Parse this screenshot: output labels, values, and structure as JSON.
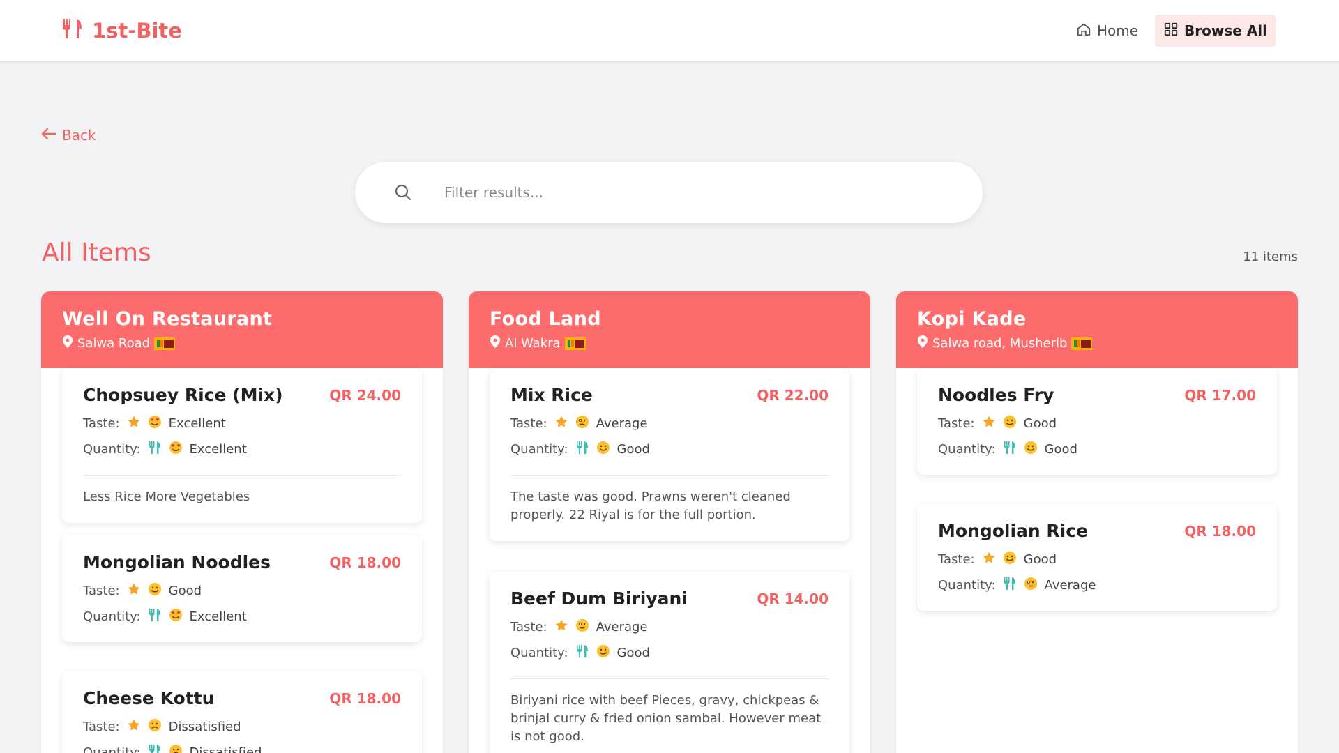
{
  "app": {
    "brand": "1st-Bite"
  },
  "nav": {
    "home": "Home",
    "browse_all": "Browse All"
  },
  "back_label": "Back",
  "search": {
    "placeholder": "Filter results..."
  },
  "section": {
    "title": "All Items",
    "count": "11 items"
  },
  "columns": [
    {
      "name": "Well On Restaurant",
      "location": "Salwa Road",
      "items": [
        {
          "name": "Chopsuey Rice (Mix)",
          "price": "QR 24.00",
          "taste_label": "Taste:",
          "taste": "Excellent",
          "taste_icon": "heart-eyes",
          "quantity_label": "Quantity:",
          "quantity": "Excellent",
          "quantity_icon": "heart-eyes",
          "note": "Less Rice More Vegetables"
        },
        {
          "name": "Mongolian Noodles",
          "price": "QR 18.00",
          "taste_label": "Taste:",
          "taste": "Good",
          "taste_icon": "smile",
          "quantity_label": "Quantity:",
          "quantity": "Excellent",
          "quantity_icon": "heart-eyes"
        },
        {
          "name": "Cheese Kottu",
          "price": "QR 18.00",
          "taste_label": "Taste:",
          "taste": "Dissatisfied",
          "taste_icon": "frown",
          "quantity_label": "Quantity:",
          "quantity": "Dissatisfied",
          "quantity_icon": "frown"
        }
      ]
    },
    {
      "name": "Food Land",
      "location": "Al Wakra",
      "items": [
        {
          "name": "Mix Rice",
          "price": "QR 22.00",
          "taste_label": "Taste:",
          "taste": "Average",
          "taste_icon": "meh",
          "quantity_label": "Quantity:",
          "quantity": "Good",
          "quantity_icon": "smile",
          "note": "The taste was good. Prawns weren't cleaned properly. 22 Riyal is for the full portion."
        },
        {
          "name": "Beef Dum Biriyani",
          "price": "QR 14.00",
          "taste_label": "Taste:",
          "taste": "Average",
          "taste_icon": "meh",
          "quantity_label": "Quantity:",
          "quantity": "Good",
          "quantity_icon": "smile",
          "note": "Biriyani rice with beef Pieces, gravy, chickpeas & brinjal curry & fried onion sambal. However meat is not good."
        }
      ]
    },
    {
      "name": "Kopi Kade",
      "location": "Salwa road, Musherib",
      "items": [
        {
          "name": "Noodles Fry",
          "price": "QR 17.00",
          "taste_label": "Taste:",
          "taste": "Good",
          "taste_icon": "smile",
          "quantity_label": "Quantity:",
          "quantity": "Good",
          "quantity_icon": "smile"
        },
        {
          "name": "Mongolian Rice",
          "price": "QR 18.00",
          "taste_label": "Taste:",
          "taste": "Good",
          "taste_icon": "smile",
          "quantity_label": "Quantity:",
          "quantity": "Average",
          "quantity_icon": "meh"
        }
      ]
    }
  ],
  "colors": {
    "accent": "#f16363",
    "header": "#fc6c6c",
    "quantity_icon": "#36c3b5",
    "star": "#f6a623"
  }
}
